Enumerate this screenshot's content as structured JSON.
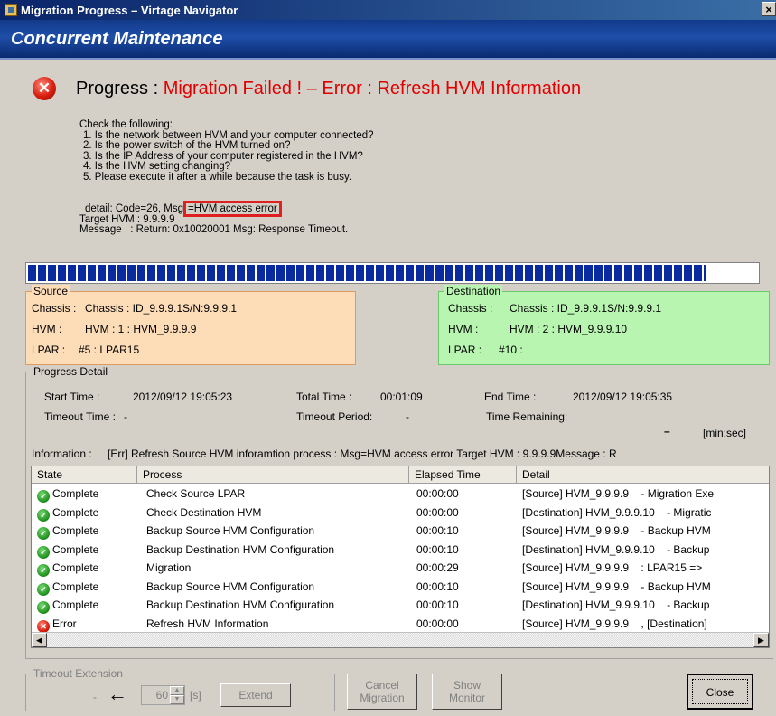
{
  "window": {
    "title": "Migration Progress – Virtage Navigator",
    "close_glyph": "×"
  },
  "banner": {
    "title": "Concurrent Maintenance"
  },
  "progress": {
    "label": "Progress :",
    "status": "Migration Failed ! – Error : Refresh HVM Information",
    "bar_fraction": 0.93
  },
  "checklist": {
    "heading": "Check the following:",
    "items": [
      "1. Is the network between HVM and your computer connected?",
      "2. Is the power switch of the HVM turned on?",
      "3. Is the IP Address of your computer registered in the HVM?",
      "4. Is the HVM setting changing?",
      "5. Please execute it after a while because the task is busy."
    ]
  },
  "detail": {
    "line1_prefix": "detail:  Code=26, Msg",
    "line1_highlight": "=HVM access error",
    "target": "Target HVM : 9.9.9.9",
    "message": "Message   : Return: 0x10020001 Msg: Response Timeout."
  },
  "source": {
    "legend": "Source",
    "chassis_label": "Chassis :",
    "chassis_value": "Chassis : ID_9.9.9.1S/N:9.9.9.1",
    "hvm_label": "HVM :",
    "hvm_value": "HVM : 1 : HVM_9.9.9.9",
    "lpar_label": "LPAR :",
    "lpar_value": "#5 : LPAR15"
  },
  "destination": {
    "legend": "Destination",
    "chassis_label": "Chassis :",
    "chassis_value": "Chassis : ID_9.9.9.1S/N:9.9.9.1",
    "hvm_label": "HVM :",
    "hvm_value": "HVM : 2 : HVM_9.9.9.10",
    "lpar_label": "LPAR :",
    "lpar_value": "#10 :"
  },
  "progress_detail": {
    "legend": "Progress Detail",
    "start_label": "Start Time :",
    "start_value": "2012/09/12 19:05:23",
    "total_label": "Total Time :",
    "total_value": "00:01:09",
    "end_label": "End Time :",
    "end_value": "2012/09/12 19:05:35",
    "timeout_label": "Timeout Time :",
    "timeout_value": "-",
    "period_label": "Timeout Period:",
    "period_value": "-",
    "remaining_label": "Time Remaining:",
    "remaining_value": "–",
    "remaining_unit": "[min:sec]",
    "info_label": "Information :",
    "info_value": "[Err] Refresh Source HVM inforamtion process : Msg=HVM access error Target HVM : 9.9.9.9Message     : R"
  },
  "table": {
    "columns": [
      "State",
      "Process",
      "Elapsed Time",
      "Detail"
    ],
    "rows": [
      {
        "state": "Complete",
        "process": "Check Source LPAR",
        "elapsed": "00:00:00",
        "detail": "[Source] HVM_9.9.9.9    - Migration Exe"
      },
      {
        "state": "Complete",
        "process": "Check Destination HVM",
        "elapsed": "00:00:00",
        "detail": "[Destination] HVM_9.9.9.10    - Migratic"
      },
      {
        "state": "Complete",
        "process": "Backup Source HVM Configuration",
        "elapsed": "00:00:10",
        "detail": "[Source] HVM_9.9.9.9    - Backup HVM"
      },
      {
        "state": "Complete",
        "process": "Backup Destination HVM Configuration",
        "elapsed": "00:00:10",
        "detail": "[Destination] HVM_9.9.9.10    - Backup"
      },
      {
        "state": "Complete",
        "process": "Migration",
        "elapsed": "00:00:29",
        "detail": "[Source] HVM_9.9.9.9    : LPAR15 =>"
      },
      {
        "state": "Complete",
        "process": "Backup Source HVM Configuration",
        "elapsed": "00:00:10",
        "detail": "[Source] HVM_9.9.9.9    - Backup HVM"
      },
      {
        "state": "Complete",
        "process": "Backup Destination HVM Configuration",
        "elapsed": "00:00:10",
        "detail": "[Destination] HVM_9.9.9.10    - Backup"
      },
      {
        "state": "Error",
        "process": "Refresh HVM Information",
        "elapsed": "00:00:00",
        "detail": "[Source] HVM_9.9.9.9    , [Destination]"
      }
    ]
  },
  "timeout_extension": {
    "legend": "Timeout Extension",
    "dash": "-",
    "spinner_value": "60",
    "unit": "[s]",
    "extend_label": "Extend"
  },
  "buttons": {
    "cancel_line1": "Cancel",
    "cancel_line2": "Migration",
    "show_line1": "Show",
    "show_line2": "Monitor",
    "close": "Close"
  },
  "colors": {
    "error_text": "#e00000",
    "source_bg": "#fddcb8",
    "destination_bg": "#b8f5b0",
    "bar": "#0a2aa0"
  }
}
